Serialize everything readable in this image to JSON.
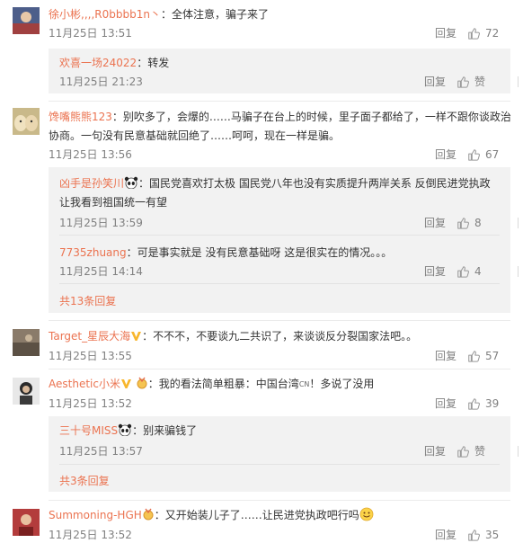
{
  "ui": {
    "reply_label": "回复",
    "like_label_zan": "赞"
  },
  "c1": {
    "user": "徐小彬,,,,R0bbbb1n丶",
    "text": "：全体注意，骗子来了",
    "time": "11月25日 13:51",
    "likes": "72"
  },
  "c1s1": {
    "user": "欢喜一场24022",
    "text": "：转发",
    "time": "11月25日 21:23"
  },
  "c2": {
    "user": "馋嘴熊熊123",
    "text": "：别吹多了，会爆的……马骗子在台上的时候，里子面子都给了，一样不跟你谈政治协商。一句没有民意基础就回绝了……呵呵，现在一样是骗。",
    "time": "11月25日 13:56",
    "likes": "67"
  },
  "c2s1": {
    "user": "凶手是孙笑川",
    "text": "：国民党喜欢打太极 国民党八年也没有实质提升两岸关系 反倒民进党执政让我看到祖国统一有望",
    "time": "11月25日 13:59",
    "likes": "8"
  },
  "c2s2": {
    "user": "7735zhuang",
    "text": "：可是事实就是 没有民意基础呀 这是很实在的情况。。。",
    "time": "11月25日 14:14",
    "likes": "4"
  },
  "c2more": "共13条回复",
  "c3": {
    "user": "Target_星辰大海",
    "text": "：不不不，不要谈九二共识了，来谈谈反分裂国家法吧。。",
    "time": "11月25日 13:55",
    "likes": "57"
  },
  "c4": {
    "user": "Aesthetic小米",
    "text": "：我的看法简单粗暴：中国台湾",
    "text2": "！多说了没用",
    "cn": "CN",
    "time": "11月25日 13:52",
    "likes": "39"
  },
  "c4s1": {
    "user": "三十号MISS",
    "text": "：别来骗钱了",
    "time": "11月25日 13:57"
  },
  "c4more": "共3条回复",
  "c5": {
    "user": "Summoning-HGH",
    "text": "：又开始装儿子了……让民进党执政吧行吗",
    "time": "11月25日 13:52",
    "likes": "35"
  },
  "colors": {
    "name": "#eb7350",
    "meta": "#808080",
    "subbg": "#f2f2f2"
  }
}
